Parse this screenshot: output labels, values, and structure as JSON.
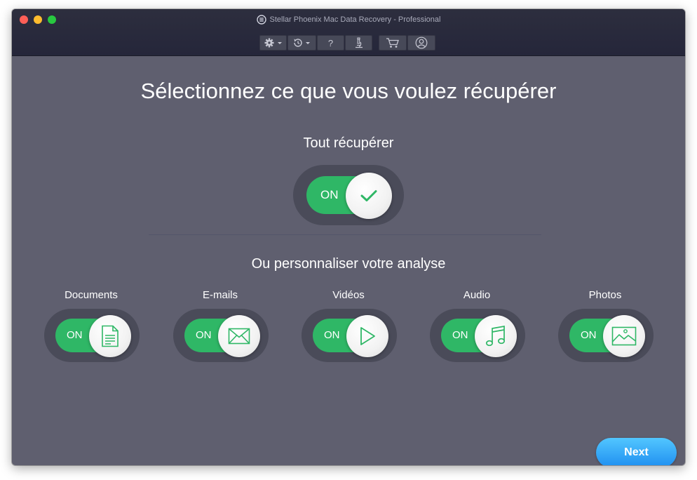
{
  "window": {
    "title": "Stellar Phoenix Mac Data Recovery - Professional"
  },
  "toolbar": {
    "buttons": [
      {
        "name": "settings",
        "icon": "gear-icon",
        "has_dropdown": true
      },
      {
        "name": "history",
        "icon": "history-icon",
        "has_dropdown": true
      },
      {
        "name": "help",
        "icon": "help-icon",
        "label": "?"
      },
      {
        "name": "microscope",
        "icon": "microscope-icon"
      },
      {
        "name": "cart",
        "icon": "cart-icon"
      },
      {
        "name": "account",
        "icon": "user-icon"
      }
    ]
  },
  "main": {
    "title": "Sélectionnez ce que vous voulez récupérer",
    "recover_all": {
      "label": "Tout récupérer",
      "state": "ON",
      "icon": "checkmark-icon"
    },
    "custom_label": "Ou personnaliser votre analyse",
    "categories": [
      {
        "label": "Documents",
        "state": "ON",
        "icon": "document-icon"
      },
      {
        "label": "E-mails",
        "state": "ON",
        "icon": "envelope-icon"
      },
      {
        "label": "Vidéos",
        "state": "ON",
        "icon": "play-icon"
      },
      {
        "label": "Audio",
        "state": "ON",
        "icon": "music-note-icon"
      },
      {
        "label": "Photos",
        "state": "ON",
        "icon": "picture-icon"
      }
    ]
  },
  "footer": {
    "next_label": "Next"
  },
  "colors": {
    "background": "#5f5f6f",
    "titlebar": "#2a2b3b",
    "toggle_on": "#2fb766",
    "icon_green": "#2fb766",
    "next_button": "#2b9cf5"
  }
}
